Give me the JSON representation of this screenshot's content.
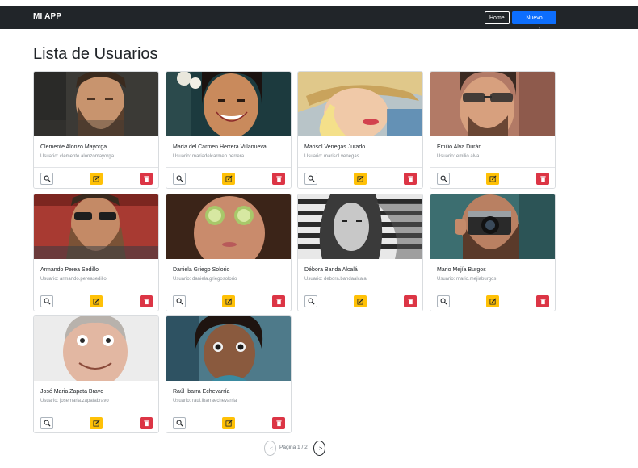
{
  "navbar": {
    "brand": "MI APP",
    "home_label": "Home",
    "new_user_label": "Nuevo usuario"
  },
  "page": {
    "title": "Lista de Usuarios"
  },
  "users": [
    {
      "name": "Clemente Alonzo Mayorga",
      "username": "Usuario: clemente.alonzomayorga"
    },
    {
      "name": "María del Carmen Herrera Villanueva",
      "username": "Usuario: mariadelcarmen.herrera"
    },
    {
      "name": "Marisol Venegas Jurado",
      "username": "Usuario: marisol.venegas"
    },
    {
      "name": "Emilio Alva Durán",
      "username": "Usuario: emilio.alva"
    },
    {
      "name": "Armando Perea Sedillo",
      "username": "Usuario: armando.pereasedillo"
    },
    {
      "name": "Daniela Griego Solorio",
      "username": "Usuario: daniela.griegosolorio"
    },
    {
      "name": "Débora Banda Alcalá",
      "username": "Usuario: debora.bandaalcala"
    },
    {
      "name": "Mario Mejía Burgos",
      "username": "Usuario: mario.mejiaburgos"
    },
    {
      "name": "José Maria Zapata Bravo",
      "username": "Usuario: josemaria.zapatabravo"
    },
    {
      "name": "Raúl Ibarra Echevarría",
      "username": "Usuario: raul.ibarraechevarria"
    }
  ],
  "pagination": {
    "prev_label": "<",
    "next_label": ">",
    "page_label": "Página 1 / 2"
  },
  "colors": {
    "navbar_bg": "#212529",
    "primary": "#0d6efd",
    "warning": "#ffc107",
    "danger": "#dc3545"
  },
  "icons": {
    "view": "magnifier-icon",
    "edit": "edit-icon",
    "delete": "trash-icon"
  }
}
